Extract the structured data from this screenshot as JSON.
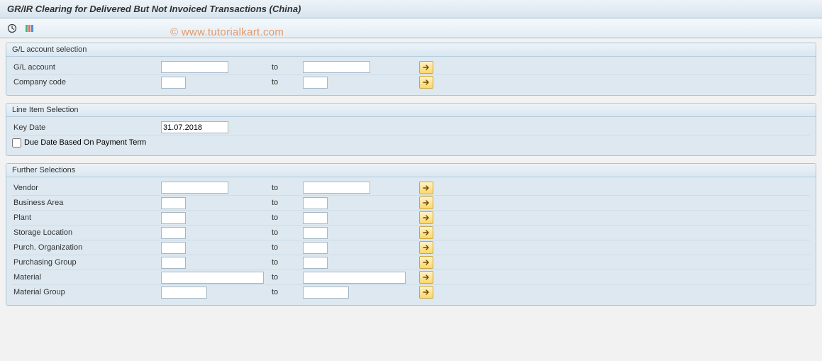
{
  "title": "GR/IR Clearing for Delivered But Not Invoiced Transactions (China)",
  "watermark": "© www.tutorialkart.com",
  "toolbar": {
    "execute_name": "execute-icon",
    "layout_name": "layout-variant-icon"
  },
  "groups": {
    "gl": {
      "header": "G/L account selection",
      "rows": [
        {
          "label": "G/L account",
          "from": "",
          "to_lbl": "to",
          "to": "",
          "width": "large"
        },
        {
          "label": "Company code",
          "from": "",
          "to_lbl": "to",
          "to": "",
          "width": "small"
        }
      ]
    },
    "line": {
      "header": "Line Item Selection",
      "key_date_label": "Key Date",
      "key_date_value": "31.07.2018",
      "due_label": "Due Date Based On Payment Term",
      "due_checked": false
    },
    "further": {
      "header": "Further Selections",
      "rows": [
        {
          "label": "Vendor",
          "width": "large"
        },
        {
          "label": "Business Area",
          "width": "small"
        },
        {
          "label": "Plant",
          "width": "small"
        },
        {
          "label": "Storage Location",
          "width": "small"
        },
        {
          "label": "Purch. Organization",
          "width": "small"
        },
        {
          "label": "Purchasing Group",
          "width": "small"
        },
        {
          "label": "Material",
          "width": "mat"
        },
        {
          "label": "Material Group",
          "width": "med"
        }
      ],
      "to_lbl": "to"
    }
  }
}
